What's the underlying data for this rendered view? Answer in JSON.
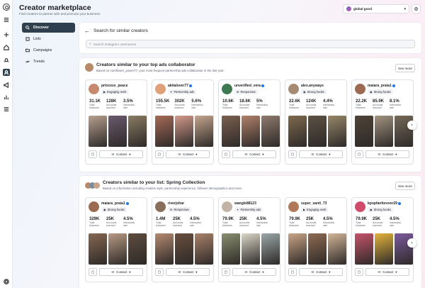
{
  "header": {
    "title": "Creator marketplace",
    "subtitle": "Find creators to partner with and promote your business.",
    "account_name": "global good"
  },
  "nav": [
    {
      "label": "Discover",
      "icon": "search-icon"
    },
    {
      "label": "Lists",
      "icon": "list-icon"
    },
    {
      "label": "Campaigns",
      "icon": "folder-icon"
    },
    {
      "label": "Trends",
      "icon": "trend-icon"
    }
  ],
  "search": {
    "heading": "Search for similar creators",
    "placeholder": "Search Instagram usernames"
  },
  "sections": [
    {
      "title": "Creators similar to your top ads collaborator",
      "subtitle": "Based on numflower_power77, your most frequent partnership ads collaborator in the last year.",
      "see_more": "See more",
      "creators": [
        {
          "name": "princess_peace",
          "verified": false,
          "badge": "Engaging reels",
          "badge_icon": "reel-icon",
          "stats": [
            "31.1K",
            "128K",
            "3.5%"
          ],
          "views": [
            "",
            "",
            ""
          ],
          "avatar": "#c88a6e",
          "photos": [
            "#b7a08f",
            "#6b5a6e",
            "#8a7b63"
          ]
        },
        {
          "name": "akitalover77",
          "verified": true,
          "badge": "Partnership ads",
          "badge_icon": "megaphone-icon",
          "stats": [
            "155.5K",
            "302K",
            "5.6%"
          ],
          "views": [
            "",
            "",
            ""
          ],
          "avatar": "#e0a07a",
          "photos": [
            "#a66a58",
            "#d39a8b",
            "#c4a58e"
          ]
        },
        {
          "name": "unverified_vera",
          "verified": true,
          "badge": "Responsive",
          "badge_icon": "chat-icon",
          "stats": [
            "10.6K",
            "18.6K",
            "5%"
          ],
          "views": [
            "",
            "",
            ""
          ],
          "avatar": "#3d7a52",
          "photos": [
            "#7b6050",
            "#b0806a",
            "#8f7a6d"
          ]
        },
        {
          "name": "alex.anyways",
          "verified": false,
          "badge": "Strong hooks",
          "badge_icon": "eye-icon",
          "stats": [
            "22.6K",
            "124K",
            "4.4%"
          ],
          "views": [
            "",
            "",
            ""
          ],
          "avatar": "#a78a72",
          "photos": [
            "#7e6a4e",
            "#5d5142",
            "#968769"
          ]
        },
        {
          "name": "maiara_praia1",
          "verified": true,
          "badge": "Strong hooks",
          "badge_icon": "eye-icon",
          "stats": [
            "22.2K",
            "85.9K",
            "8.1%"
          ],
          "views": [
            "",
            "",
            ""
          ],
          "avatar": "#9c6a50",
          "photos": [
            "#4f4338",
            "#a29380",
            "#76695a"
          ]
        }
      ]
    },
    {
      "title": "Creators similar to your list: Spring Collection",
      "subtitle": "Based on information including creative style, partnership experience, follower demographics and more.",
      "see_more": "See more",
      "creators": [
        {
          "name": "maiara_praia1",
          "verified": true,
          "badge": "Strong hooks",
          "badge_icon": "eye-icon",
          "stats": [
            "329K",
            "25K",
            "4.5%"
          ],
          "views": [
            "",
            "",
            ""
          ],
          "avatar": "#9c6a50",
          "photos": [
            "#866852",
            "#b89a84",
            "#5e4c3e"
          ]
        },
        {
          "name": "riverjohar",
          "verified": false,
          "badge": "Responsive",
          "badge_icon": "chat-icon",
          "stats": [
            "1.4M",
            "25K",
            "4.5%"
          ],
          "views": [
            "",
            "",
            ""
          ],
          "avatar": "#8a6e5c",
          "photos": [
            "#b58a72",
            "#6a4e3e",
            "#a9826a"
          ]
        },
        {
          "name": "wangle88123",
          "verified": false,
          "badge": "Partnership ads",
          "badge_icon": "megaphone-icon",
          "stats": [
            "79.9K",
            "25K",
            "4.5%"
          ],
          "views": [
            "",
            "",
            ""
          ],
          "avatar": "#c2b4a6",
          "photos": [
            "#8a8f70",
            "#dcd7c8",
            "#9aa7a8"
          ]
        },
        {
          "name": "super_santi_73",
          "verified": false,
          "badge": "Engaging reels",
          "badge_icon": "reel-icon",
          "stats": [
            "79.9K",
            "25K",
            "4.5%"
          ],
          "views": [
            "",
            "",
            ""
          ],
          "avatar": "#b07a5a",
          "photos": [
            "#caa586",
            "#8e6b53",
            "#d2b598"
          ]
        },
        {
          "name": "kpopfanforever29",
          "verified": true,
          "badge": "Strong hooks",
          "badge_icon": "eye-icon",
          "stats": [
            "79.9K",
            "25K",
            "4.5%"
          ],
          "views": [
            "",
            "",
            ""
          ],
          "avatar": "#d04a6a",
          "photos": [
            "#c7546a",
            "#e3b33e",
            "#7c5a9e"
          ]
        }
      ]
    }
  ],
  "labels": {
    "followers": "Total followers",
    "reached": "Accounts reached",
    "rate": "Interaction rate",
    "contact": "Contact"
  },
  "colors": {
    "active_nav": "#2e3f4e",
    "verified": "#1877f2"
  }
}
